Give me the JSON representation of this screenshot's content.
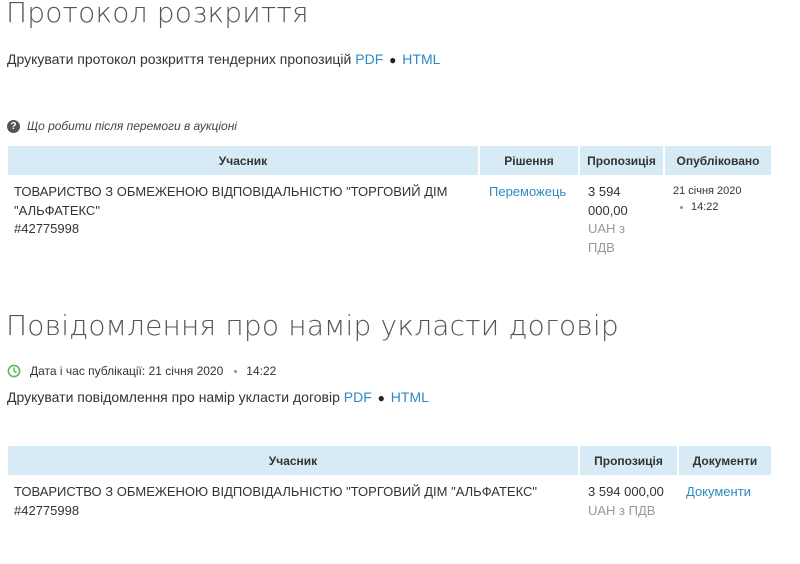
{
  "protocol": {
    "title": "Протокол розкриття",
    "print_text": "Друкувати протокол розкриття тендерних пропозицій",
    "pdf": "PDF",
    "html": "HTML",
    "help_link": "Що робити після перемоги в аукціоні",
    "table": {
      "headers": {
        "participant": "Учасник",
        "decision": "Рішення",
        "offer": "Пропозиція",
        "published": "Опубліковано"
      },
      "row": {
        "participant_line1": "ТОВАРИСТВО З ОБМЕЖЕНОЮ ВІДПОВІДАЛЬНІСТЮ \"ТОРГОВИЙ ДІМ",
        "participant_line2": "\"АЛЬФАТЕКС\"",
        "participant_id": "#42775998",
        "decision": "Переможець",
        "offer_line1": "3 594",
        "offer_line2": "000,00",
        "currency_line1": "UAH з",
        "currency_line2": "ПДВ",
        "date": "21 січня 2020",
        "time": "14:22"
      }
    }
  },
  "intent": {
    "title": "Повідомлення про намір укласти договір",
    "pub_label": "Дата і час публікації: 21 січня 2020",
    "pub_time": "14:22",
    "print_text": "Друкувати повідомлення про намір укласти договір",
    "pdf": "PDF",
    "html": "HTML",
    "table": {
      "headers": {
        "participant": "Учасник",
        "offer": "Пропозиція",
        "documents": "Документи"
      },
      "row": {
        "participant_line1": "ТОВАРИСТВО З ОБМЕЖЕНОЮ ВІДПОВІДАЛЬНІСТЮ \"ТОРГОВИЙ ДІМ \"АЛЬФАТЕКС\"",
        "participant_id": "#42775998",
        "offer": "3 594 000,00",
        "currency": "UAH з ПДВ",
        "documents_link": "Документи"
      }
    }
  },
  "colors": {
    "link": "#2d8ac4",
    "header_bg": "#d6ebf6",
    "muted": "#999999",
    "green": "#5cb85c"
  },
  "separator_glyph": "●"
}
